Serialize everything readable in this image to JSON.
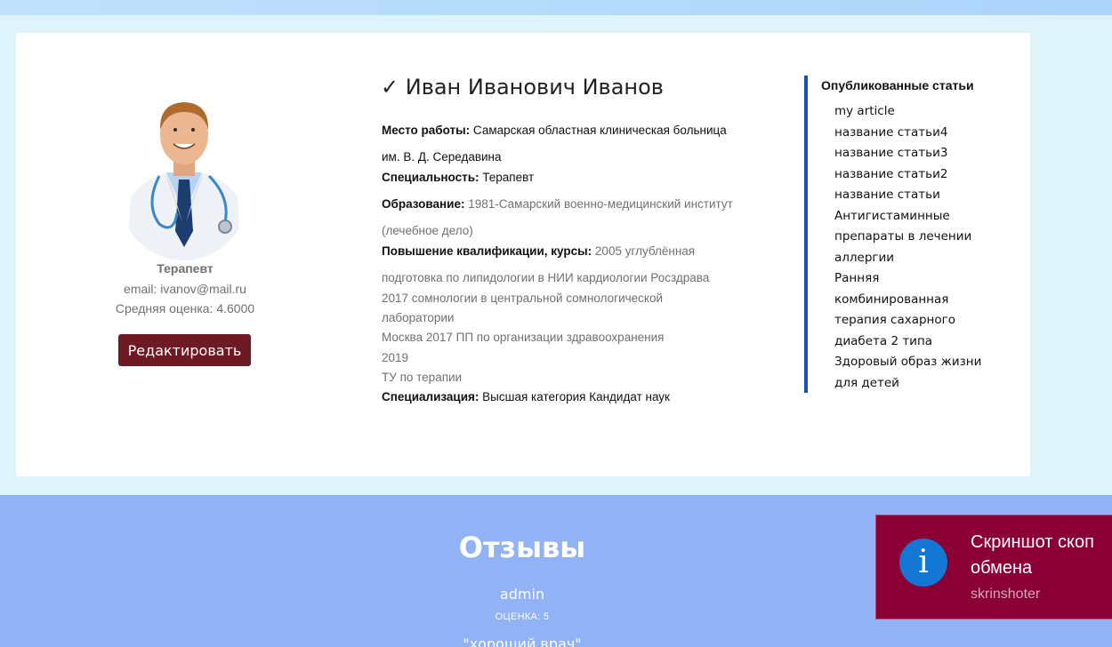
{
  "profile": {
    "name": "✓ Иван Иванович Иванов",
    "role": "Терапевт",
    "email": "email: ivanov@mail.ru",
    "rating": "Средняя оценка: 4.6000",
    "edit_button": "Редактировать"
  },
  "details": {
    "workplace_label": "Место работы:",
    "workplace_line1": "Самарская областная клиническая больница",
    "workplace_line2": "им. В. Д. Середавина",
    "specialty_label": "Специальность:",
    "specialty_value": "Терапевт",
    "education_label": "Образование:",
    "education_line1": "1981-Самарский военно-медицинский институт",
    "education_line2": "(лечебное дело)",
    "qualification_label": "Повышение квалификации, курсы:",
    "qualification_lines": [
      "2005 углублённая",
      "подготовка по липидологии в НИИ кардиологии Росздрава",
      "2017 сомнологии в центральной сомнологической",
      "лаборатории",
      "Москва 2017 ПП по организации здравоохранения",
      "2019",
      "ТУ по терапии"
    ],
    "specialization_label": "Специализация:",
    "specialization_value": "Высшая категория Кандидат наук"
  },
  "articles": {
    "title": "Опубликованные статьи",
    "items": [
      "my article",
      "название статьи4",
      "название статьи3",
      "название статьи2",
      "название статьи",
      "Антигистаминные препараты в лечении аллергии",
      "Ранняя комбинированная терапия сахарного диабета 2 типа",
      "Здоровый образ жизни для детей"
    ]
  },
  "reviews": {
    "title": "Отзывы",
    "author": "admin",
    "score": "ОЦЕНКА: 5",
    "text": "\"хороший врач\""
  },
  "toast": {
    "icon": "info-icon",
    "title_line1": "Скриншот скоп",
    "title_line2": "обмена",
    "subtitle": "skrinshoter"
  },
  "colors": {
    "accent": "#6e1a24",
    "articles_bar": "#1a4fb4",
    "reviews_bg": "#91b3f6",
    "toast_bg": "#8a0036"
  }
}
